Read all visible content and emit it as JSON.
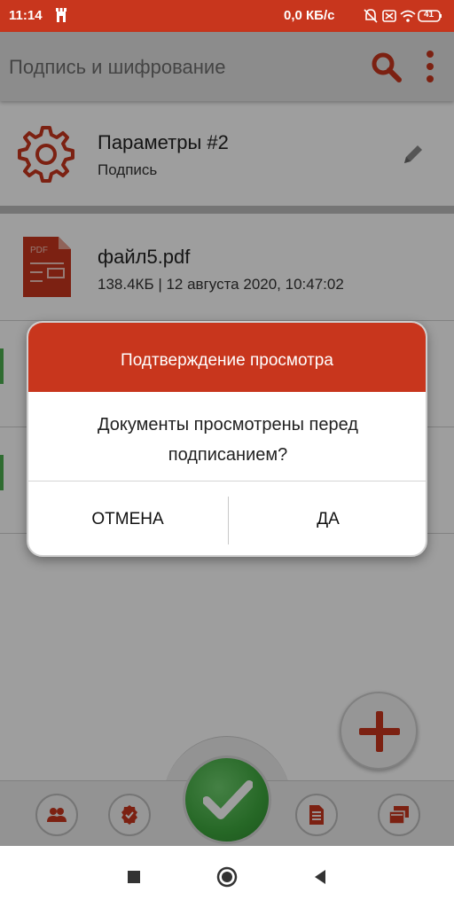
{
  "status_bar": {
    "time": "11:14",
    "speed": "0,0 КБ/с",
    "battery": "41",
    "icons": [
      "tower-icon",
      "bell-off-icon",
      "sim-off-icon",
      "wifi-icon",
      "battery-icon"
    ]
  },
  "app_bar": {
    "title": "Подпись и шифрование",
    "search_icon": "search-icon",
    "more_icon": "more-vert-icon"
  },
  "params": {
    "title": "Параметры #2",
    "subtitle": "Подпись",
    "icon": "gear-icon",
    "edit_icon": "pencil-icon"
  },
  "files": [
    {
      "name": "файл5.pdf",
      "meta": "138.4КБ | 12 августа 2020, 10:47:02",
      "icon": "pdf-file-icon"
    }
  ],
  "dialog": {
    "title": "Подтверждение просмотра",
    "message": "Документы просмотрены перед подписанием?",
    "cancel_label": "ОТМЕНА",
    "ok_label": "ДА"
  },
  "bottom_nav": {
    "items": [
      "contacts-icon",
      "certificate-icon",
      "confirm-check-icon",
      "document-icon",
      "windows-icon"
    ]
  },
  "fab": {
    "icon": "plus-icon"
  },
  "colors": {
    "accent": "#c8361d",
    "confirm_green": "#3ea83e",
    "appbar_bg": "#e3e3e3"
  }
}
